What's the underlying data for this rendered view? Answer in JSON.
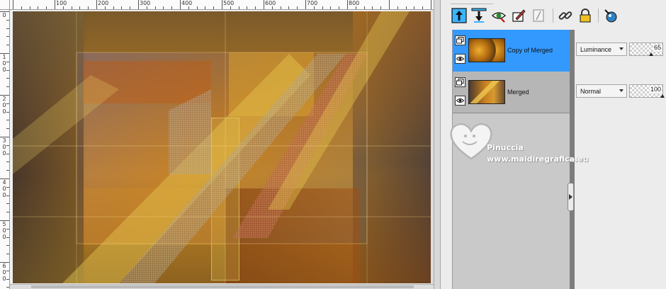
{
  "canvas": {
    "ruler_top_labels": [
      "100",
      "200",
      "300",
      "400",
      "500",
      "600",
      "700",
      "800"
    ],
    "ruler_left_labels": [
      "0",
      "1",
      "2",
      "3",
      "4",
      "5",
      "6"
    ],
    "ruler_left_sub": "0 0"
  },
  "toolbar": {
    "icons": [
      "move-layer-up-icon",
      "move-layer-down-icon",
      "edit-selection-icon",
      "edit-layer-icon",
      "lock-transparency-icon",
      "link-icon",
      "lock-icon",
      "pick-tool-icon"
    ]
  },
  "layers": [
    {
      "name": "Copy of Merged",
      "blend_mode": "Luminance",
      "opacity": "65",
      "opacity_fraction": 0.65,
      "selected": true,
      "selected_color": "#3399ff"
    },
    {
      "name": "Merged",
      "blend_mode": "Normal",
      "opacity": "100",
      "opacity_fraction": 1.0,
      "selected": false
    }
  ],
  "watermark": {
    "line1": "Pinuccia",
    "line2": "www.maidiregrafica.eu"
  }
}
